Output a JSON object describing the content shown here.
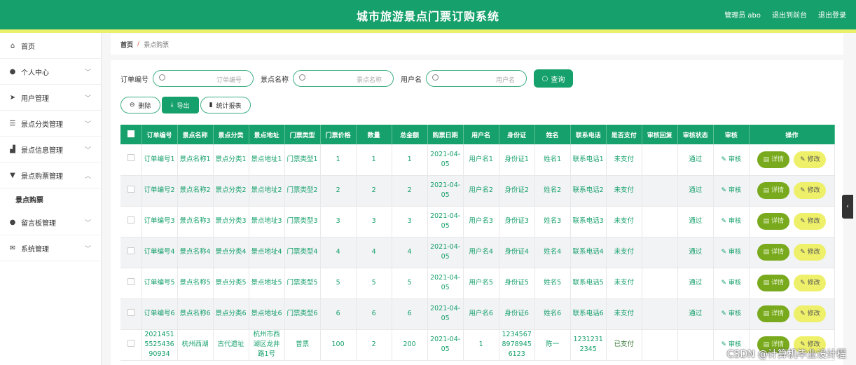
{
  "header": {
    "title": "城市旅游景点门票订购系统",
    "admin": "管理员 abo",
    "back_front": "退出到前台",
    "logout": "退出登录"
  },
  "sidebar": {
    "items": [
      {
        "label": "首页",
        "icon": "home-icon"
      },
      {
        "label": "个人中心",
        "icon": "user-icon"
      },
      {
        "label": "用户管理",
        "icon": "send-icon"
      },
      {
        "label": "景点分类管理",
        "icon": "sliders-icon"
      },
      {
        "label": "景点信息管理",
        "icon": "chart-icon"
      },
      {
        "label": "景点购票管理",
        "icon": "ticket-icon"
      },
      {
        "label": "留言板管理",
        "icon": "pin-icon"
      },
      {
        "label": "系统管理",
        "icon": "mail-icon"
      }
    ],
    "sub_active": "景点购票"
  },
  "breadcrumb": {
    "home": "首页",
    "sep": "/",
    "current": "景点购票"
  },
  "search": {
    "order_label": "订单编号",
    "order_placeholder": "订单编号",
    "spot_label": "景点名称",
    "spot_placeholder": "景点名称",
    "user_label": "用户名",
    "user_placeholder": "用户名",
    "query_label": "查询"
  },
  "ops": {
    "delete": "删除",
    "export": "导出",
    "stats": "统计报表"
  },
  "table": {
    "headers": [
      "订单编号",
      "景点名称",
      "景点分类",
      "景点地址",
      "门票类型",
      "门票价格",
      "数量",
      "总金额",
      "购票日期",
      "用户名",
      "身份证",
      "姓名",
      "联系电话",
      "是否支付",
      "审核回复",
      "审核状态",
      "审核",
      "操作"
    ],
    "detail_label": "详情",
    "edit_label": "修改",
    "audit_label": "审核",
    "rows": [
      [
        "订单编号1",
        "景点名称1",
        "景点分类1",
        "景点地址1",
        "门票类型1",
        "1",
        "1",
        "1",
        "2021-04-05",
        "用户名1",
        "身份证1",
        "姓名1",
        "联系电话1",
        "未支付",
        "",
        "通过"
      ],
      [
        "订单编号2",
        "景点名称2",
        "景点分类2",
        "景点地址2",
        "门票类型2",
        "2",
        "2",
        "2",
        "2021-04-05",
        "用户名2",
        "身份证2",
        "姓名2",
        "联系电话2",
        "未支付",
        "",
        "通过"
      ],
      [
        "订单编号3",
        "景点名称3",
        "景点分类3",
        "景点地址3",
        "门票类型3",
        "3",
        "3",
        "3",
        "2021-04-05",
        "用户名3",
        "身份证3",
        "姓名3",
        "联系电话3",
        "未支付",
        "",
        "通过"
      ],
      [
        "订单编号4",
        "景点名称4",
        "景点分类4",
        "景点地址4",
        "门票类型4",
        "4",
        "4",
        "4",
        "2021-04-05",
        "用户名4",
        "身份证4",
        "姓名4",
        "联系电话4",
        "未支付",
        "",
        "通过"
      ],
      [
        "订单编号5",
        "景点名称5",
        "景点分类5",
        "景点地址5",
        "门票类型5",
        "5",
        "5",
        "5",
        "2021-04-05",
        "用户名5",
        "身份证5",
        "姓名5",
        "联系电话5",
        "未支付",
        "",
        "通过"
      ],
      [
        "订单编号6",
        "景点名称6",
        "景点分类6",
        "景点地址6",
        "门票类型6",
        "6",
        "6",
        "6",
        "2021-04-05",
        "用户名6",
        "身份证6",
        "姓名6",
        "联系电话6",
        "未支付",
        "",
        "通过"
      ],
      [
        "20214515525436 90934",
        "杭州西湖",
        "古代遗址",
        "杭州市西湖区龙井路1号",
        "普票",
        "100",
        "2",
        "200",
        "2021-04-05",
        "1",
        "12345678978945 6123",
        "陈一",
        "12312312345",
        "已支付",
        "",
        ""
      ]
    ]
  },
  "watermark": "CSDN @计算机毕业设计程"
}
